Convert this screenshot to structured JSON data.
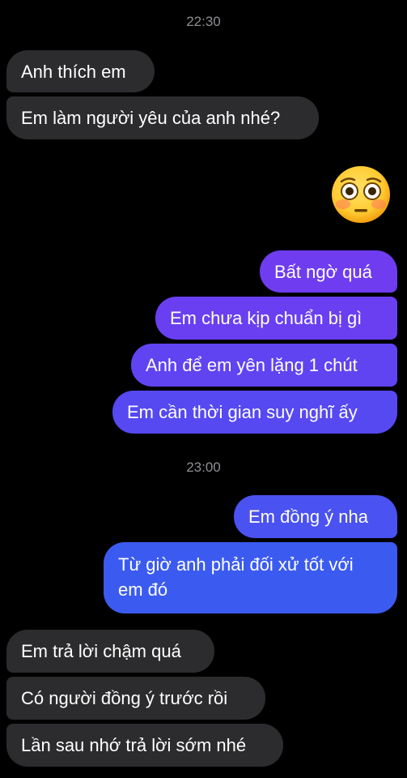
{
  "timestamps": {
    "first": "22:30",
    "second": "23:00"
  },
  "messages": {
    "m1": "Anh thích em",
    "m2": "Em làm người yêu của anh nhé?",
    "emoji_icon": "flushed-face-emoji",
    "m3": "Bất ngờ quá",
    "m4": "Em chưa kịp chuẩn bị gì",
    "m5": "Anh để em yên lặng 1 chút",
    "m6": "Em cần thời gian suy nghĩ ấy",
    "m7": "Em đồng ý nha",
    "m8": "Từ giờ anh phải đối xử tốt với em đó",
    "m9": "Em trả lời chậm quá",
    "m10": "Có người đồng ý trước rồi",
    "m11": "Lần sau nhớ trả lời sớm nhé"
  },
  "colors": {
    "background": "#000000",
    "incoming_bubble": "#2c2c2e",
    "outgoing_purple": "#6f3cf0",
    "outgoing_blue": "#3b5bf0",
    "timestamp_text": "#8e8e93"
  }
}
